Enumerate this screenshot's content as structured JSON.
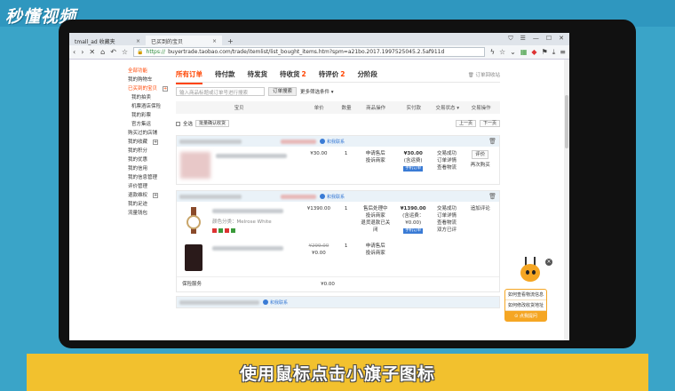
{
  "watermark": {
    "logo_text": "秒懂视频"
  },
  "browser": {
    "tabs": [
      {
        "label": "tmall_ad 收藏夹",
        "active": false
      },
      {
        "label": "已买到的宝贝",
        "active": true
      }
    ],
    "new_tab": "+",
    "address": {
      "scheme": "https://",
      "url": "buyertrade.taobao.com/trade/itemlist/list_bought_items.htm?spm=a21bo.2017.1997525045.2.5af911d"
    }
  },
  "sidebar": {
    "items": [
      {
        "label": "全部功能",
        "style": "head"
      },
      {
        "label": "我的购物车",
        "style": "normal"
      },
      {
        "label": "已买到的宝贝",
        "style": "sel",
        "plus": true
      },
      {
        "label": "我的拍卖",
        "style": "indent"
      },
      {
        "label": "机票酒店保险",
        "style": "indent"
      },
      {
        "label": "我的彩票",
        "style": "indent"
      },
      {
        "label": "官方集运",
        "style": "indent"
      },
      {
        "label": "购买过的店铺",
        "style": "normal"
      },
      {
        "label": "我的收藏",
        "style": "normal",
        "plus": true
      },
      {
        "label": "我的积分",
        "style": "normal"
      },
      {
        "label": "我的优惠",
        "style": "normal"
      },
      {
        "label": "我的信用",
        "style": "normal"
      },
      {
        "label": "我的信息管理",
        "style": "normal"
      },
      {
        "label": "评价管理",
        "style": "normal"
      },
      {
        "label": "退款维权",
        "style": "normal",
        "plus": true
      },
      {
        "label": "我的足迹",
        "style": "normal"
      },
      {
        "label": "流量钱包",
        "style": "normal"
      }
    ]
  },
  "main": {
    "tabs": [
      {
        "label": "所有订单",
        "count": "",
        "active": true
      },
      {
        "label": "待付款",
        "count": "",
        "active": false
      },
      {
        "label": "待发货",
        "count": "",
        "active": false
      },
      {
        "label": "待收货",
        "count": "2",
        "active": false
      },
      {
        "label": "待评价",
        "count": "2",
        "active": false
      },
      {
        "label": "分阶段",
        "count": "",
        "active": false
      }
    ],
    "recycle": "订单回收站",
    "search_placeholder": "输入商品标题或订单号进行搜索",
    "search_button": "订单搜索",
    "more_filter": "更多筛选条件 ▾",
    "columns": [
      "宝贝",
      "单价",
      "数量",
      "商品操作",
      "实付款",
      "交易状态 ▾",
      "交易操作"
    ],
    "select_all": "全选",
    "batch_confirm": "批量确认收货",
    "prev_page": "上一页",
    "next_page": "下一页",
    "contact": "和我联系",
    "orders": [
      {
        "items": [
          {
            "thumb": "blur",
            "price": "¥30.00",
            "old_price": "",
            "qty": "1",
            "ops": [
              "申请售后",
              "投诉商家"
            ]
          }
        ],
        "paid": "¥30.00",
        "paid_note": "(含运费)",
        "paid_badge": "手机订单",
        "status": [
          "交易成功",
          "订单详情",
          "查看物流"
        ],
        "actions": [
          "评价",
          "再次购买"
        ]
      },
      {
        "items": [
          {
            "thumb": "watch",
            "spec": "颜色分类：Melrose White",
            "price": "¥1390.00",
            "old_price": "",
            "qty": "1",
            "ops": [
              "售后处理中",
              "投诉商家",
              "退货退款已关闭"
            ]
          },
          {
            "thumb": "phone",
            "spec": "",
            "price": "¥0.00",
            "old_price": "¥299.00",
            "qty": "1",
            "ops": [
              "申请售后",
              "投诉商家"
            ]
          }
        ],
        "paid": "¥1390.00",
        "paid_note": "(含运费：¥0.00)",
        "paid_badge": "手机订单",
        "status": [
          "交易成功",
          "订单详情",
          "查看物流",
          "双方已评"
        ],
        "actions": [
          "追加评论"
        ],
        "extra_label": "保险服务",
        "extra_price": "¥0.00"
      }
    ]
  },
  "assistant": {
    "questions": [
      "如何查看物流信息",
      "如何修改收货地址"
    ],
    "ask_label": "点我提问",
    "close": "×"
  },
  "caption": "使用鼠标点击小旗子图标",
  "colors": {
    "accent": "#ff4400",
    "link": "#3a7bd5",
    "caption_bar": "#f2c12e",
    "bg": "#3aa4c8"
  }
}
